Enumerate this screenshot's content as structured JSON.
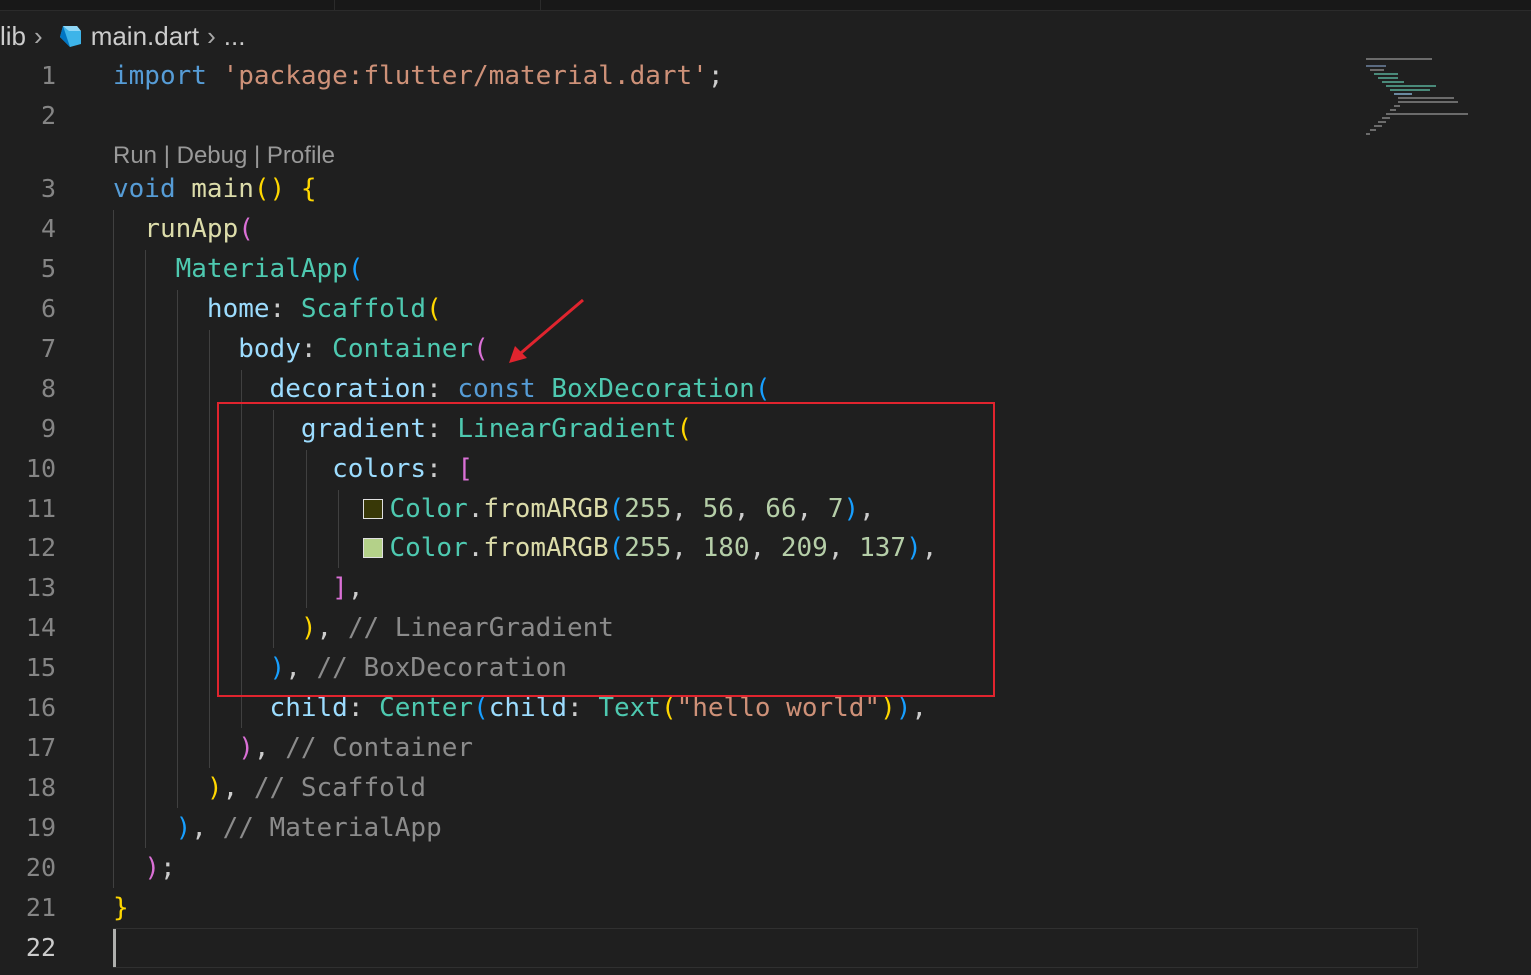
{
  "breadcrumb": {
    "folder": "lib",
    "file": "main.dart",
    "more": "..."
  },
  "codelens": {
    "run": "Run",
    "debug": "Debug",
    "profile": "Profile",
    "separator": " | "
  },
  "editor": {
    "active_line": 22,
    "highlight_color": "#e0242e",
    "background": "#1f1f1f",
    "swatches": {
      "color1": "#383807",
      "color2": "#b4d189"
    },
    "lines": [
      {
        "no": "1",
        "tokens": [
          {
            "t": "import",
            "c": "kw"
          },
          {
            "t": " ",
            "c": "punc"
          },
          {
            "t": "'package:flutter/material.dart'",
            "c": "str"
          },
          {
            "t": ";",
            "c": "punc"
          }
        ]
      },
      {
        "no": "2",
        "tokens": []
      },
      {
        "no": "3",
        "tokens": [
          {
            "t": "void",
            "c": "kw"
          },
          {
            "t": " ",
            "c": "punc"
          },
          {
            "t": "main",
            "c": "fn"
          },
          {
            "t": "()",
            "c": "b1"
          },
          {
            "t": " ",
            "c": "punc"
          },
          {
            "t": "{",
            "c": "b1"
          }
        ]
      },
      {
        "no": "4",
        "tokens": [
          {
            "t": "  ",
            "c": "punc"
          },
          {
            "t": "runApp",
            "c": "fn"
          },
          {
            "t": "(",
            "c": "b2"
          }
        ]
      },
      {
        "no": "5",
        "tokens": [
          {
            "t": "    ",
            "c": "punc"
          },
          {
            "t": "MaterialApp",
            "c": "cls"
          },
          {
            "t": "(",
            "c": "b3"
          }
        ]
      },
      {
        "no": "6",
        "tokens": [
          {
            "t": "      ",
            "c": "punc"
          },
          {
            "t": "home",
            "c": "prop"
          },
          {
            "t": ": ",
            "c": "punc"
          },
          {
            "t": "Scaffold",
            "c": "cls"
          },
          {
            "t": "(",
            "c": "b1"
          }
        ]
      },
      {
        "no": "7",
        "tokens": [
          {
            "t": "        ",
            "c": "punc"
          },
          {
            "t": "body",
            "c": "prop"
          },
          {
            "t": ": ",
            "c": "punc"
          },
          {
            "t": "Container",
            "c": "cls"
          },
          {
            "t": "(",
            "c": "b2"
          }
        ]
      },
      {
        "no": "8",
        "tokens": [
          {
            "t": "          ",
            "c": "punc"
          },
          {
            "t": "decoration",
            "c": "prop"
          },
          {
            "t": ": ",
            "c": "punc"
          },
          {
            "t": "const",
            "c": "kw"
          },
          {
            "t": " ",
            "c": "punc"
          },
          {
            "t": "BoxDecoration",
            "c": "cls"
          },
          {
            "t": "(",
            "c": "b3"
          }
        ]
      },
      {
        "no": "9",
        "tokens": [
          {
            "t": "            ",
            "c": "punc"
          },
          {
            "t": "gradient",
            "c": "prop"
          },
          {
            "t": ": ",
            "c": "punc"
          },
          {
            "t": "LinearGradient",
            "c": "cls"
          },
          {
            "t": "(",
            "c": "b1"
          }
        ]
      },
      {
        "no": "10",
        "tokens": [
          {
            "t": "              ",
            "c": "punc"
          },
          {
            "t": "colors",
            "c": "prop"
          },
          {
            "t": ": ",
            "c": "punc"
          },
          {
            "t": "[",
            "c": "b2"
          }
        ]
      },
      {
        "no": "11",
        "tokens": [
          {
            "t": "                ",
            "c": "punc"
          },
          {
            "t": "",
            "c": "sw1"
          },
          {
            "t": "Color",
            "c": "cls"
          },
          {
            "t": ".",
            "c": "punc"
          },
          {
            "t": "fromARGB",
            "c": "fn"
          },
          {
            "t": "(",
            "c": "b3"
          },
          {
            "t": "255",
            "c": "num"
          },
          {
            "t": ", ",
            "c": "punc"
          },
          {
            "t": "56",
            "c": "num"
          },
          {
            "t": ", ",
            "c": "punc"
          },
          {
            "t": "66",
            "c": "num"
          },
          {
            "t": ", ",
            "c": "punc"
          },
          {
            "t": "7",
            "c": "num"
          },
          {
            "t": ")",
            "c": "b3"
          },
          {
            "t": ",",
            "c": "punc"
          }
        ]
      },
      {
        "no": "12",
        "tokens": [
          {
            "t": "                ",
            "c": "punc"
          },
          {
            "t": "",
            "c": "sw2"
          },
          {
            "t": "Color",
            "c": "cls"
          },
          {
            "t": ".",
            "c": "punc"
          },
          {
            "t": "fromARGB",
            "c": "fn"
          },
          {
            "t": "(",
            "c": "b3"
          },
          {
            "t": "255",
            "c": "num"
          },
          {
            "t": ", ",
            "c": "punc"
          },
          {
            "t": "180",
            "c": "num"
          },
          {
            "t": ", ",
            "c": "punc"
          },
          {
            "t": "209",
            "c": "num"
          },
          {
            "t": ", ",
            "c": "punc"
          },
          {
            "t": "137",
            "c": "num"
          },
          {
            "t": ")",
            "c": "b3"
          },
          {
            "t": ",",
            "c": "punc"
          }
        ]
      },
      {
        "no": "13",
        "tokens": [
          {
            "t": "              ",
            "c": "punc"
          },
          {
            "t": "]",
            "c": "b2"
          },
          {
            "t": ",",
            "c": "punc"
          }
        ]
      },
      {
        "no": "14",
        "tokens": [
          {
            "t": "            ",
            "c": "punc"
          },
          {
            "t": ")",
            "c": "b1"
          },
          {
            "t": ", ",
            "c": "punc"
          },
          {
            "t": "// LinearGradient",
            "c": "cmt"
          }
        ]
      },
      {
        "no": "15",
        "tokens": [
          {
            "t": "          ",
            "c": "punc"
          },
          {
            "t": ")",
            "c": "b3"
          },
          {
            "t": ", ",
            "c": "punc"
          },
          {
            "t": "// BoxDecoration",
            "c": "cmt"
          }
        ]
      },
      {
        "no": "16",
        "tokens": [
          {
            "t": "          ",
            "c": "punc"
          },
          {
            "t": "child",
            "c": "prop"
          },
          {
            "t": ": ",
            "c": "punc"
          },
          {
            "t": "Center",
            "c": "cls"
          },
          {
            "t": "(",
            "c": "b3"
          },
          {
            "t": "child",
            "c": "prop"
          },
          {
            "t": ": ",
            "c": "punc"
          },
          {
            "t": "Text",
            "c": "cls"
          },
          {
            "t": "(",
            "c": "b1"
          },
          {
            "t": "\"hello world\"",
            "c": "str"
          },
          {
            "t": ")",
            "c": "b1"
          },
          {
            "t": ")",
            "c": "b3"
          },
          {
            "t": ",",
            "c": "punc"
          }
        ]
      },
      {
        "no": "17",
        "tokens": [
          {
            "t": "        ",
            "c": "punc"
          },
          {
            "t": ")",
            "c": "b2"
          },
          {
            "t": ", ",
            "c": "punc"
          },
          {
            "t": "// Container",
            "c": "cmt"
          }
        ]
      },
      {
        "no": "18",
        "tokens": [
          {
            "t": "      ",
            "c": "punc"
          },
          {
            "t": ")",
            "c": "b1"
          },
          {
            "t": ", ",
            "c": "punc"
          },
          {
            "t": "// Scaffold",
            "c": "cmt"
          }
        ]
      },
      {
        "no": "19",
        "tokens": [
          {
            "t": "    ",
            "c": "punc"
          },
          {
            "t": ")",
            "c": "b3"
          },
          {
            "t": ", ",
            "c": "punc"
          },
          {
            "t": "// MaterialApp",
            "c": "cmt"
          }
        ]
      },
      {
        "no": "20",
        "tokens": [
          {
            "t": "  ",
            "c": "punc"
          },
          {
            "t": ")",
            "c": "b2"
          },
          {
            "t": ";",
            "c": "punc"
          }
        ]
      },
      {
        "no": "21",
        "tokens": [
          {
            "t": "}",
            "c": "b1"
          }
        ]
      },
      {
        "no": "22",
        "tokens": []
      }
    ]
  }
}
